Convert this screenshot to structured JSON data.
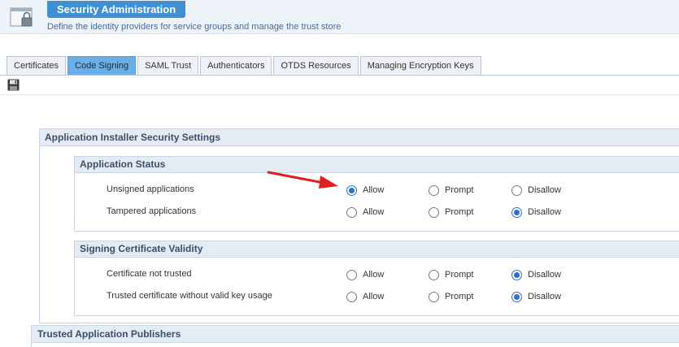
{
  "header": {
    "title": "Security Administration",
    "subtitle": "Define the identity providers for service groups and manage the trust store",
    "icon": "lock-window-icon"
  },
  "tabs": [
    {
      "label": "Certificates",
      "active": false
    },
    {
      "label": "Code Signing",
      "active": true
    },
    {
      "label": "SAML Trust",
      "active": false
    },
    {
      "label": "Authenticators",
      "active": false
    },
    {
      "label": "OTDS Resources",
      "active": false
    },
    {
      "label": "Managing Encryption Keys",
      "active": false
    }
  ],
  "toolbar": {
    "save_icon": "save-icon"
  },
  "installer": {
    "title": "Application Installer Security Settings",
    "status": {
      "title": "Application Status",
      "rows": [
        {
          "label": "Unsigned applications",
          "options": [
            "Allow",
            "Prompt",
            "Disallow"
          ],
          "selected": "Allow"
        },
        {
          "label": "Tampered applications",
          "options": [
            "Allow",
            "Prompt",
            "Disallow"
          ],
          "selected": "Disallow"
        }
      ]
    },
    "validity": {
      "title": "Signing Certificate Validity",
      "rows": [
        {
          "label": "Certificate not trusted",
          "options": [
            "Allow",
            "Prompt",
            "Disallow"
          ],
          "selected": "Disallow"
        },
        {
          "label": "Trusted certificate without valid key usage",
          "options": [
            "Allow",
            "Prompt",
            "Disallow"
          ],
          "selected": "Disallow"
        }
      ]
    }
  },
  "publishers": {
    "title": "Trusted Application Publishers"
  },
  "colors": {
    "accent": "#3f8fd2",
    "active_tab": "#6aaee6",
    "radio_selected": "#2a6fd6",
    "arrow": "#e02020"
  }
}
